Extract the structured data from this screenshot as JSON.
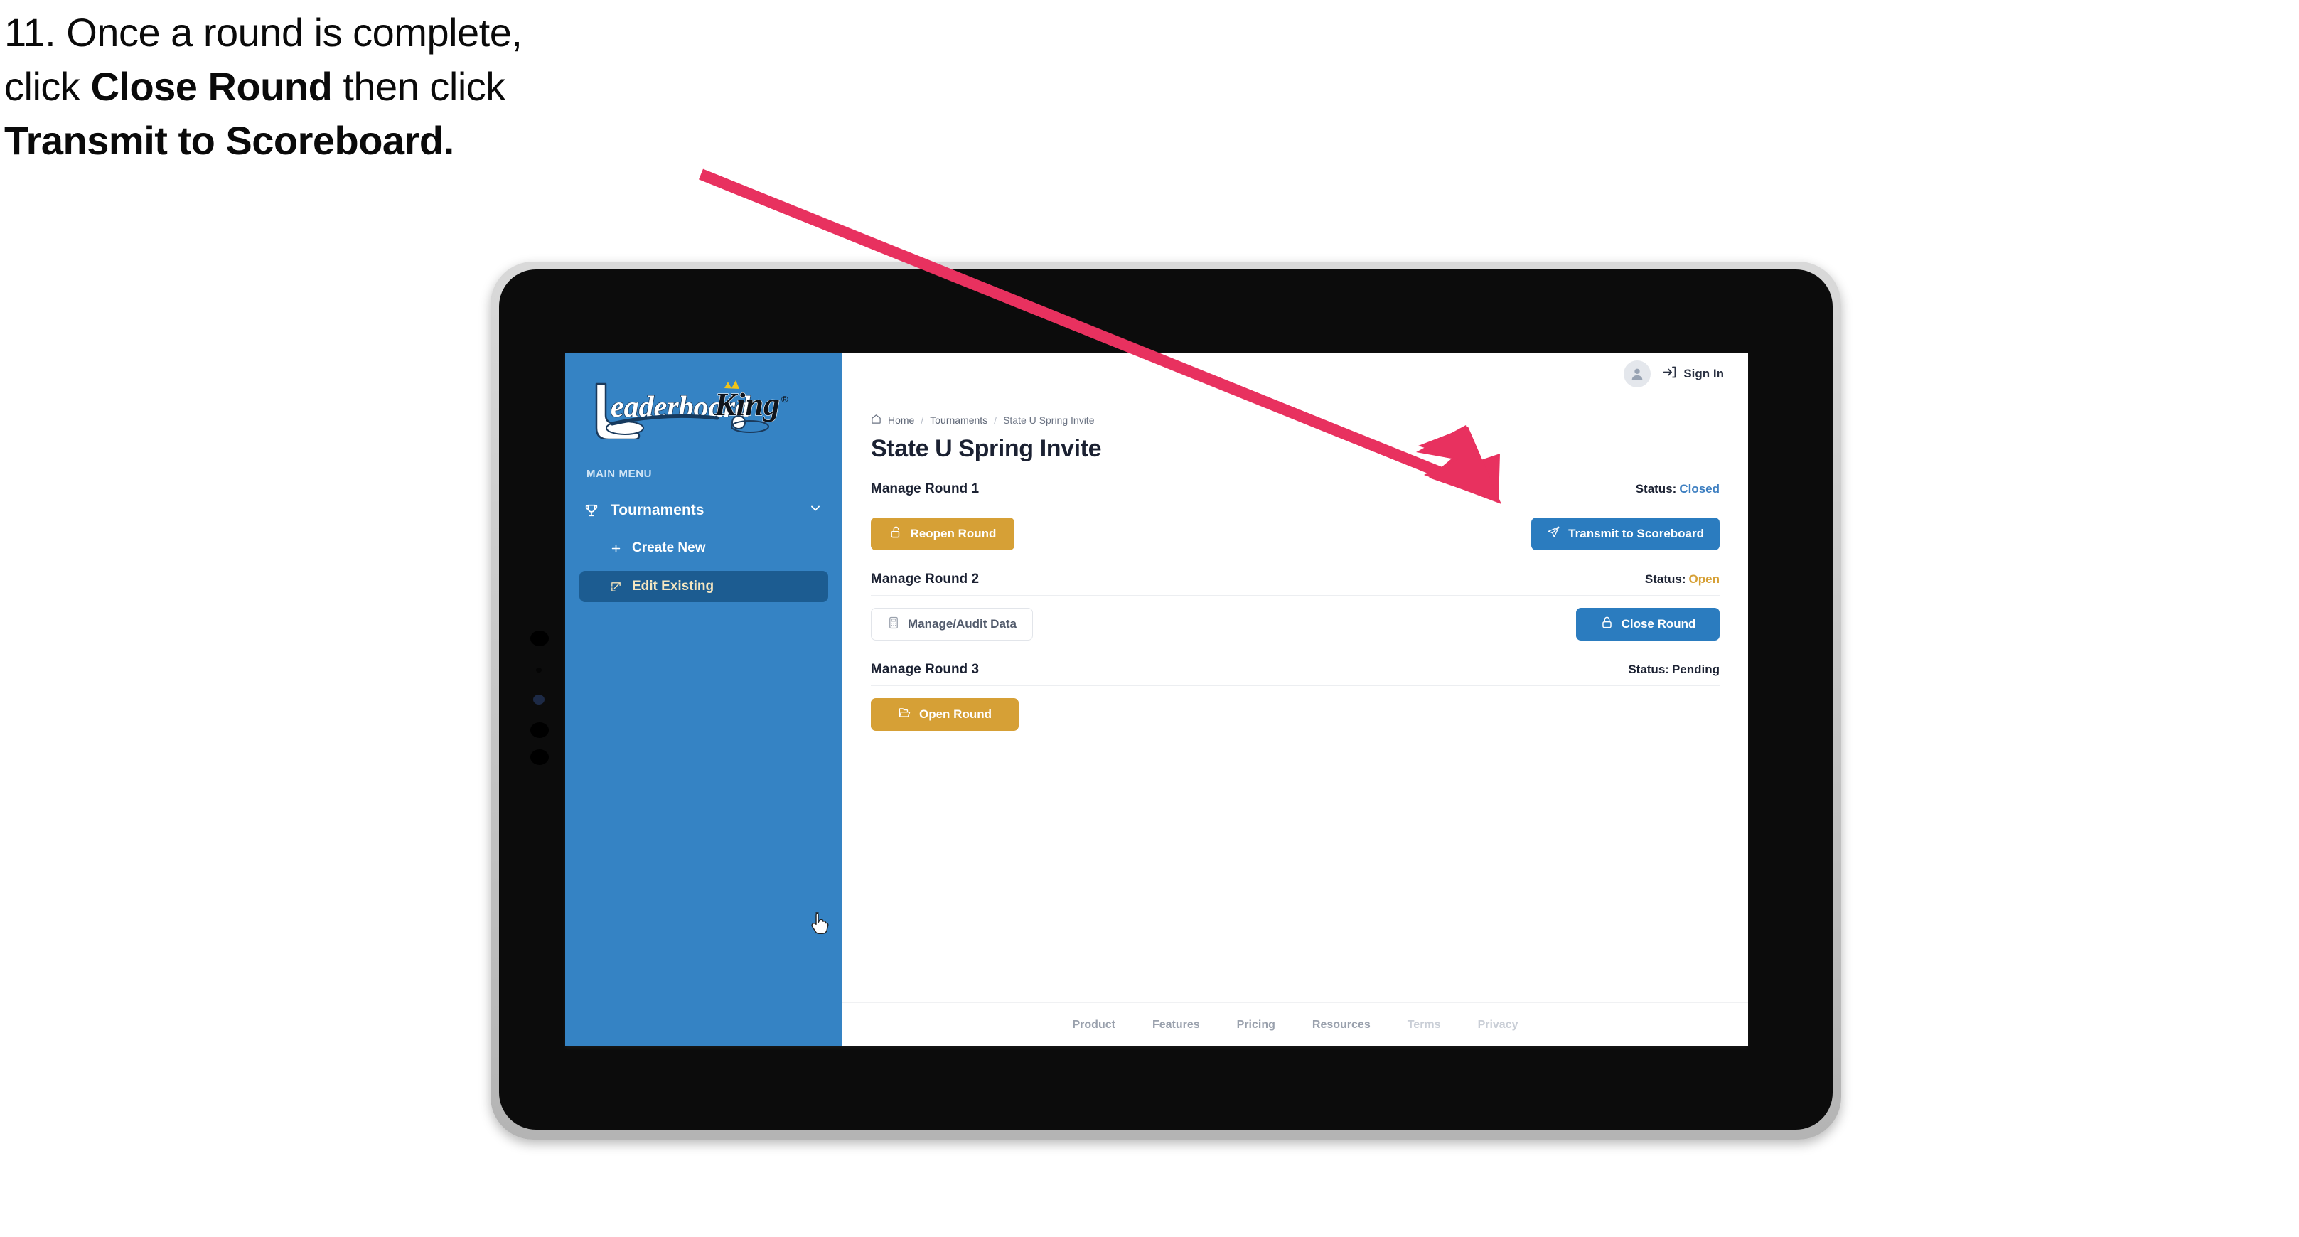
{
  "caption": {
    "line1": "11. Once a round is complete,",
    "line2_pre": "click ",
    "line2_bold": "Close Round",
    "line2_post": " then click",
    "line3_bold": "Transmit to Scoreboard."
  },
  "annotation": {
    "arrow_color": "#E8315F"
  },
  "colors": {
    "sidebar_blue": "#3583C4",
    "sidebar_active": "#1C5C91",
    "accent_gold": "#D6A036",
    "accent_blue": "#2B7CBF",
    "status_closed": "#3E7FC1",
    "status_open": "#D6A036",
    "status_pending": "#1B2132"
  },
  "sidebar": {
    "brand": "LeaderboardKing",
    "menu_label": "MAIN MENU",
    "nav": {
      "label": "Tournaments",
      "icon": "trophy-icon",
      "chevron": "chevron-down-icon"
    },
    "items": [
      {
        "label": "Create New",
        "icon": "plus-icon",
        "active": false
      },
      {
        "label": "Edit Existing",
        "icon": "edit-square-icon",
        "active": true
      }
    ]
  },
  "topbar": {
    "avatar_icon": "user-avatar-icon",
    "signin_icon": "login-arrow-icon",
    "signin_label": "Sign In"
  },
  "breadcrumb": {
    "home_icon": "home-icon",
    "items": [
      "Home",
      "Tournaments",
      "State U Spring Invite"
    ],
    "separator": "/"
  },
  "page": {
    "title": "State U Spring Invite"
  },
  "rounds": [
    {
      "title": "Manage Round 1",
      "status_label": "Status:",
      "status_value": "Closed",
      "status_color": "#3E7FC1",
      "left_button": {
        "label": "Reopen Round",
        "icon": "unlock-icon",
        "style": "gold"
      },
      "right_button": {
        "label": "Transmit to Scoreboard",
        "icon": "paper-plane-icon",
        "style": "blue"
      }
    },
    {
      "title": "Manage Round 2",
      "status_label": "Status:",
      "status_value": "Open",
      "status_color": "#D6A036",
      "left_button": {
        "label": "Manage/Audit Data",
        "icon": "calculator-icon",
        "style": "ghost"
      },
      "right_button": {
        "label": "Close Round",
        "icon": "lock-icon",
        "style": "blue"
      }
    },
    {
      "title": "Manage Round 3",
      "status_label": "Status:",
      "status_value": "Pending",
      "status_color": "#1B2132",
      "left_button": {
        "label": "Open Round",
        "icon": "folder-open-icon",
        "style": "gold"
      },
      "right_button": null
    }
  ],
  "footer": {
    "links": [
      {
        "label": "Product",
        "dim": false
      },
      {
        "label": "Features",
        "dim": false
      },
      {
        "label": "Pricing",
        "dim": false
      },
      {
        "label": "Resources",
        "dim": false
      },
      {
        "label": "Terms",
        "dim": true
      },
      {
        "label": "Privacy",
        "dim": true
      }
    ]
  }
}
